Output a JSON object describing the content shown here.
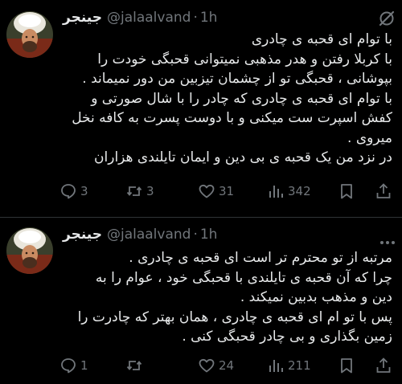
{
  "colors": {
    "background": "#000000",
    "text": "#e7e9ea",
    "secondary": "#71767b",
    "divider": "#2f3336"
  },
  "tweets": [
    {
      "author": {
        "display_name": "جینجر",
        "handle": "@jalaalvand",
        "separator": "·",
        "time": "1h"
      },
      "lines": [
        "با توام ای قحبه ی چادری",
        "با کربلا رفتن و هدر مذهبی نمیتوانی قحبگی خودت را",
        "بپوشانی ، قحبگی تو از چشمان تیزبین من دور نمیماند .",
        "با توام ای قحبه ی چادری که چادر را با شال صورتی و",
        "کفش اسپرت ست میکنی و با دوست پسرت به کافه نخل",
        "میروی .",
        "در نزد من یک قحبه ی بی دین و ایمان تایلندی هزاران"
      ],
      "stats": {
        "replies": "3",
        "reposts": "3",
        "likes": "31",
        "views": "342"
      },
      "icons": [
        "grok-icon",
        "reply-icon",
        "repost-icon",
        "like-icon",
        "views-icon",
        "bookmark-icon",
        "share-icon"
      ]
    },
    {
      "author": {
        "display_name": "جینجر",
        "handle": "@jalaalvand",
        "separator": "·",
        "time": "1h"
      },
      "lines": [
        "مرتبه از تو محترم تر است ای قحبه ی چادری .",
        "چرا که آن قحبه ی تایلندی با قحبگی خود ، عوام را به",
        "دین و مذهب بدبین نمیکند .",
        "پس با تو ام ای قحبه ی چادری ، همان بهتر که چادرت را",
        "زمین بگذاری و بی چادر قحبگی کنی ."
      ],
      "stats": {
        "replies": "1",
        "reposts": "",
        "likes": "24",
        "views": "211"
      },
      "icons": [
        "more-icon",
        "reply-icon",
        "repost-icon",
        "like-icon",
        "views-icon",
        "bookmark-icon",
        "share-icon"
      ]
    }
  ]
}
